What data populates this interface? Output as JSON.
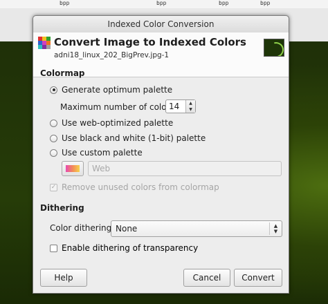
{
  "background": {
    "rulers": [
      "bpp",
      "bpp",
      "bpp",
      "bpp"
    ]
  },
  "dialog": {
    "window_title": "Indexed Color Conversion",
    "header_title": "Convert Image to Indexed Colors",
    "header_subtitle": "adni18_linux_202_BigPrev.jpg-1",
    "colormap_section": "Colormap",
    "options": {
      "generate_optimum": "Generate optimum palette",
      "max_colors_label": "Maximum number of colors:",
      "max_colors_value": "14",
      "web_optimized": "Use web-optimized palette",
      "black_white": "Use black and white (1-bit) palette",
      "custom_palette": "Use custom palette",
      "custom_palette_name": "Web",
      "remove_unused": "Remove unused colors from colormap"
    },
    "dithering_section": "Dithering",
    "color_dithering_label": "Color dithering:",
    "color_dithering_value": "None",
    "dither_transparency": "Enable dithering of transparency",
    "buttons": {
      "help": "Help",
      "cancel": "Cancel",
      "convert": "Convert"
    },
    "selected_option": "generate_optimum",
    "remove_unused_checked": true,
    "dither_transparency_checked": false
  }
}
